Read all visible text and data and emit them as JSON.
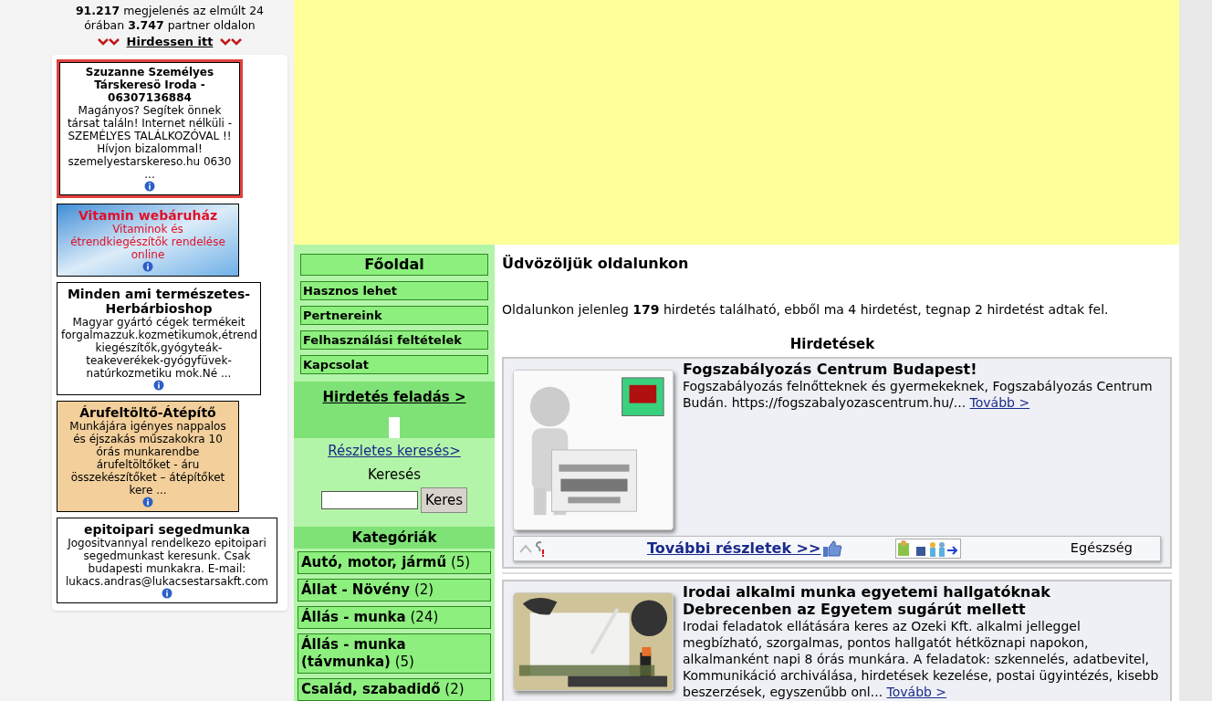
{
  "stats": {
    "text": "**91.217** megjelenés az elmúlt 24 órában **3.747** partner oldalon",
    "link": "Hirdessen itt"
  },
  "side_ads": [
    {
      "kind": "highlight",
      "title": "Szuzanne Személyes Társkeresö Iroda - 06307136884",
      "text": "Magányos? Segítek önnek társat találn! Internet nélküli - SZEMÉLYES TALÁLKOZÓVAL !! Hívjon bizalommal! szemelyestarskereso.hu 0630 ..."
    },
    {
      "kind": "gradient",
      "title": "Vitamin webáruház",
      "text": "Vitaminok és étrendkiegészítők rendelése online"
    },
    {
      "kind": "plain",
      "title": "Minden ami természetes-Herbárbioshop",
      "text": "Magyar gyártó cégek termékeit forgalmazzuk.kozmetikumok,étrend kiegészítők,gyógyteák-teakeverékek-gyógyfüvek-natúrkozmetiku mok.Né ..."
    },
    {
      "kind": "tan",
      "title": "Árufeltöltő-Átépítő",
      "text": "Munkájára igényes nappalos és éjszakás műszakokra 10 órás munkarendbe árufeltöltőket - áru összekészítőket – átépítőket kere ..."
    },
    {
      "kind": "plain",
      "title": "epitoipari segedmunka",
      "text": "Jogositvannyal rendelkezo epitoipari segedmunkast keresunk. Csak budapesti munkakra. E-mail: lukacs.andras@lukacsestarsakft.com"
    }
  ],
  "menu": [
    {
      "kind": "main",
      "label": "Főoldal"
    },
    {
      "kind": "link",
      "label": "Hasznos lehet"
    },
    {
      "kind": "link",
      "label": "Pertnereink"
    },
    {
      "kind": "link",
      "label": "Felhasználási feltételek"
    },
    {
      "kind": "link",
      "label": "Kapcsolat"
    }
  ],
  "post_ad": "Hirdetés feladás >",
  "search": {
    "detailed": "Részletes keresés>",
    "label": "Keresés",
    "button": "Keres"
  },
  "categories": {
    "title": "Kategóriák",
    "items": [
      {
        "name": "Autó, motor, jármű",
        "count": "(5)"
      },
      {
        "name": "Állat - Növény",
        "count": "(2)"
      },
      {
        "name": "Állás - munka",
        "count": "(24)"
      },
      {
        "name": "Állás - munka (távmunka)",
        "count": "(5)"
      },
      {
        "name": "Család, szabadidő",
        "count": "(2)"
      }
    ]
  },
  "welcome": {
    "title": "Üdvözöljük oldalunkon",
    "text": "Oldalunkon jelenleg **179** hirdetés található, ebből ma 4 hirdetést, tegnap 2 hirdetést adtak fel."
  },
  "listings": {
    "title": "Hirdetések",
    "items": [
      {
        "kind": "placeholder",
        "title": "Fogszabályozás Centrum Budapest!",
        "text": "Fogszabályozás felnőtteknek és gyermekeknek, Fogszabályozás Centrum Budán. https://fogszabalyozascentrum.hu/...",
        "more": "Tovább >",
        "details": "További részletek >>",
        "category": "Egészség"
      },
      {
        "title": "Irodai alkalmi munka egyetemi hallgatóknak Debrecenben az Egyetem sugárút mellett",
        "text": "Irodai feladatok ellátására keres az Ozeki Kft. alkalmi jelleggel megbízható, szorgalmas, pontos hallgatót hétköznapi napokon, alkalmanként napi 8 órás munkára. A feladatok: szkennelés, adatbevitel, Kommunikáció archiválása, hirdetések kezelése, postai ügyintézés, kisebb beszerzések, egyszenűbb onl...",
        "more": "Tovább >"
      }
    ]
  }
}
